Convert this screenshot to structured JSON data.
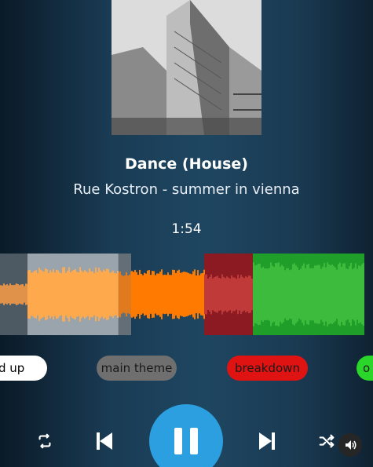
{
  "track": {
    "title": "Dance (House)",
    "artist_album": "Rue Kostron - summer in vienna",
    "current_time": "1:54"
  },
  "sections": [
    {
      "label": "d up",
      "color": "#ffffff"
    },
    {
      "label": "main theme",
      "color": "#6f6f6f"
    },
    {
      "label": "breakdown",
      "color": "#e01313"
    },
    {
      "label": "o",
      "color": "#2bd62b"
    }
  ],
  "waveform_colors": {
    "played_gray": "#5a6670",
    "light_orange": "#ffa94d",
    "orange": "#ff7a00",
    "dark_red": "#8b1a22",
    "green": "#3cbb3c"
  },
  "controls": {
    "repeat_icon": "repeat-icon",
    "previous_icon": "previous-icon",
    "play_pause_icon": "pause-icon",
    "play_button_color": "#2b9fe0",
    "next_icon": "next-icon",
    "shuffle_icon": "shuffle-icon",
    "volume_icon": "volume-icon"
  }
}
